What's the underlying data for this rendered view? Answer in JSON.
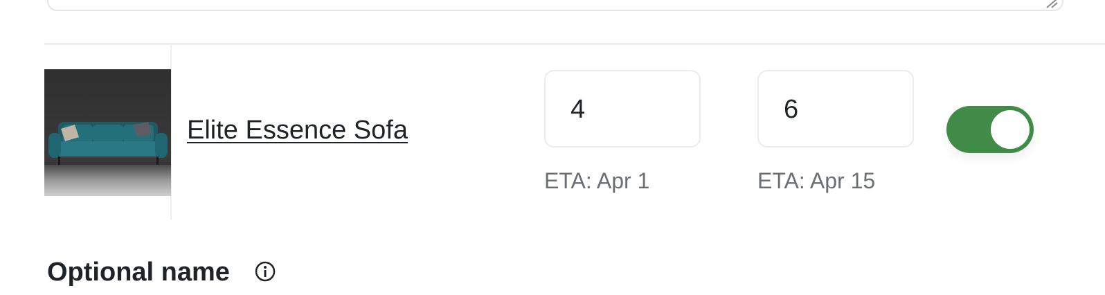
{
  "product": {
    "name": "Elite Essence Sofa",
    "image_alt": "teal velvet sofa",
    "quantity_1": "4",
    "eta_1": "ETA: Apr 1",
    "quantity_2": "6",
    "eta_2": "ETA: Apr 15",
    "enabled": true
  },
  "optional_name": {
    "label": "Optional name"
  },
  "colors": {
    "toggle_on": "#3f8b47",
    "divider": "#eeeeee",
    "muted_text": "#6b6f73"
  },
  "icons": {
    "info": "info-icon",
    "resize": "resize-handle-icon"
  }
}
